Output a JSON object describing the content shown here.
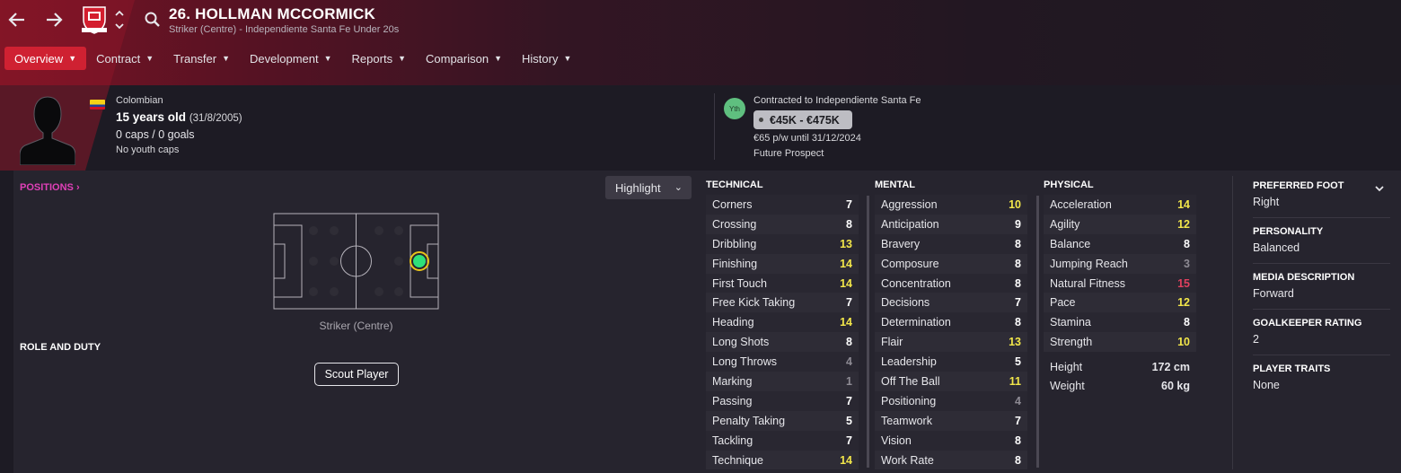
{
  "header": {
    "title": "26. HOLLMAN MCCORMICK",
    "subtitle": "Striker (Centre) - Independiente Santa Fe Under 20s",
    "back_icon": "arrow-left-icon",
    "forward_icon": "arrow-right-icon"
  },
  "tabs": [
    {
      "label": "Overview"
    },
    {
      "label": "Contract"
    },
    {
      "label": "Transfer"
    },
    {
      "label": "Development"
    },
    {
      "label": "Reports"
    },
    {
      "label": "Comparison"
    },
    {
      "label": "History"
    }
  ],
  "info": {
    "nationality": "Colombian",
    "age": "15 years old",
    "dob": "(31/8/2005)",
    "caps": "0 caps / 0 goals",
    "youth_caps": "No youth caps"
  },
  "contract": {
    "badge": "Yth",
    "contracted_to": "Contracted to Independiente Santa Fe",
    "value": "€45K - €475K",
    "wage": "€65 p/w until 31/12/2024",
    "status": "Future Prospect"
  },
  "positions": {
    "link": "POSITIONS ›",
    "highlight": "Highlight",
    "position_label": "Striker (Centre)",
    "role_duty": "ROLE AND DUTY",
    "scout_button": "Scout Player",
    "marker_color": "#2ee07a"
  },
  "technical": {
    "title": "TECHNICAL",
    "rows": [
      {
        "name": "Corners",
        "value": "7"
      },
      {
        "name": "Crossing",
        "value": "8"
      },
      {
        "name": "Dribbling",
        "value": "13"
      },
      {
        "name": "Finishing",
        "value": "14"
      },
      {
        "name": "First Touch",
        "value": "14"
      },
      {
        "name": "Free Kick Taking",
        "value": "7"
      },
      {
        "name": "Heading",
        "value": "14"
      },
      {
        "name": "Long Shots",
        "value": "8"
      },
      {
        "name": "Long Throws",
        "value": "4"
      },
      {
        "name": "Marking",
        "value": "1"
      },
      {
        "name": "Passing",
        "value": "7"
      },
      {
        "name": "Penalty Taking",
        "value": "5"
      },
      {
        "name": "Tackling",
        "value": "7"
      },
      {
        "name": "Technique",
        "value": "14"
      }
    ]
  },
  "mental": {
    "title": "MENTAL",
    "rows": [
      {
        "name": "Aggression",
        "value": "10"
      },
      {
        "name": "Anticipation",
        "value": "9"
      },
      {
        "name": "Bravery",
        "value": "8"
      },
      {
        "name": "Composure",
        "value": "8"
      },
      {
        "name": "Concentration",
        "value": "8"
      },
      {
        "name": "Decisions",
        "value": "7"
      },
      {
        "name": "Determination",
        "value": "8"
      },
      {
        "name": "Flair",
        "value": "13"
      },
      {
        "name": "Leadership",
        "value": "5"
      },
      {
        "name": "Off The Ball",
        "value": "11"
      },
      {
        "name": "Positioning",
        "value": "4"
      },
      {
        "name": "Teamwork",
        "value": "7"
      },
      {
        "name": "Vision",
        "value": "8"
      },
      {
        "name": "Work Rate",
        "value": "8"
      }
    ]
  },
  "physical": {
    "title": "PHYSICAL",
    "rows": [
      {
        "name": "Acceleration",
        "value": "14"
      },
      {
        "name": "Agility",
        "value": "12"
      },
      {
        "name": "Balance",
        "value": "8"
      },
      {
        "name": "Jumping Reach",
        "value": "3"
      },
      {
        "name": "Natural Fitness",
        "value": "15"
      },
      {
        "name": "Pace",
        "value": "12"
      },
      {
        "name": "Stamina",
        "value": "8"
      },
      {
        "name": "Strength",
        "value": "10"
      }
    ],
    "height_label": "Height",
    "height_value": "172 cm",
    "weight_label": "Weight",
    "weight_value": "60 kg"
  },
  "colors": {
    "white": "#ffffff",
    "yellow": "#f2e64a",
    "grey": "#8e8b94",
    "red": "#e0405e"
  },
  "side": {
    "preferred_foot_label": "PREFERRED FOOT",
    "preferred_foot": "Right",
    "personality_label": "PERSONALITY",
    "personality": "Balanced",
    "media_label": "MEDIA DESCRIPTION",
    "media": "Forward",
    "gk_label": "GOALKEEPER RATING",
    "gk": "2",
    "traits_label": "PLAYER TRAITS",
    "traits": "None"
  }
}
